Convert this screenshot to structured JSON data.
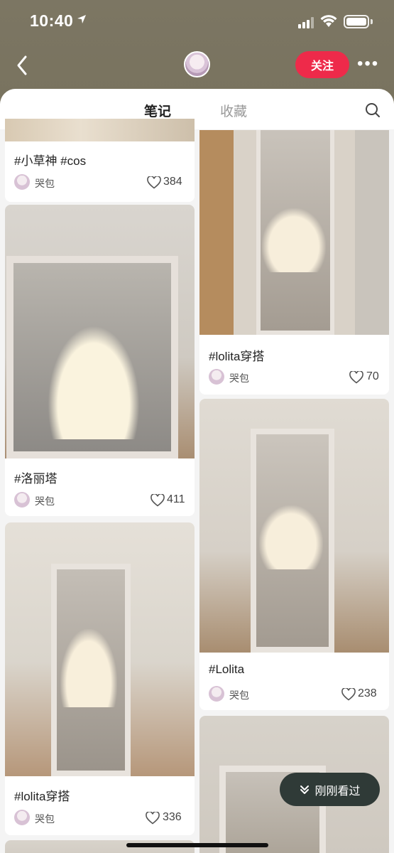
{
  "status_bar": {
    "time": "10:40"
  },
  "header": {
    "follow_label": "关注"
  },
  "tabs": [
    {
      "label": "笔记"
    },
    {
      "label": "收藏"
    }
  ],
  "notes": [
    {
      "title": "#小草神 #cos",
      "author": "哭包",
      "likes": "384"
    },
    {
      "title": "#洛丽塔",
      "author": "哭包",
      "likes": "411"
    },
    {
      "title": "#lolita穿搭",
      "author": "哭包",
      "likes": "336"
    },
    {
      "title": "#lolita穿搭",
      "author": "哭包",
      "likes": "70"
    },
    {
      "title": "#Lolita",
      "author": "哭包",
      "likes": "238"
    }
  ],
  "floating_button": {
    "label": "刚刚看过"
  },
  "colors": {
    "accent": "#ee2a4a",
    "header_bg": "#7a7460",
    "sheet_bg": "#f4f4f4"
  }
}
